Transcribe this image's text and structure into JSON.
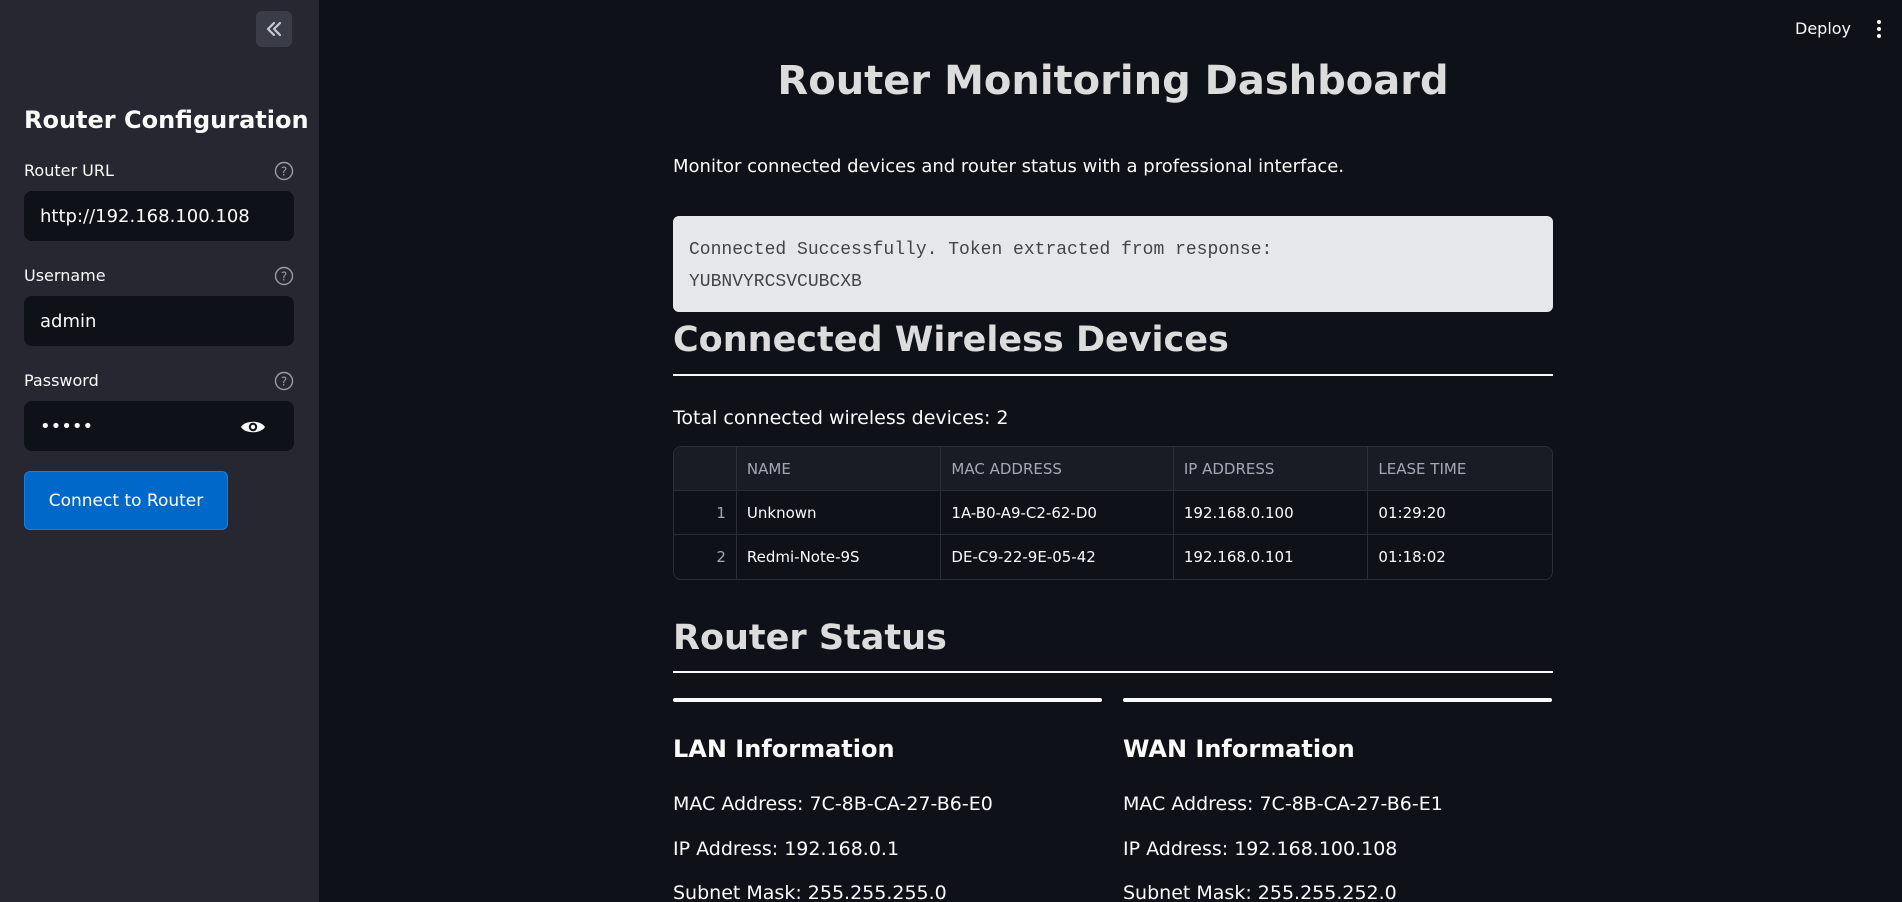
{
  "sidebar": {
    "title": "Router Configuration",
    "router_url": {
      "label": "Router URL",
      "value": "http://192.168.100.108"
    },
    "username": {
      "label": "Username",
      "value": "admin"
    },
    "password": {
      "label": "Password",
      "value": "•••••"
    },
    "connect_label": "Connect to Router"
  },
  "header": {
    "deploy_label": "Deploy"
  },
  "main": {
    "title": "Router Monitoring Dashboard",
    "intro": "Monitor connected devices and router status with a professional interface.",
    "status_line1": "Connected Successfully. Token extracted from response:",
    "status_line2": "YUBNVYRCSVCUBCXB",
    "devices_heading": "Connected Wireless Devices",
    "device_count": "Total connected wireless devices: 2",
    "table": {
      "headers": [
        "NAME",
        "MAC ADDRESS",
        "IP ADDRESS",
        "LEASE TIME"
      ],
      "rows": [
        {
          "idx": "1",
          "name": "Unknown",
          "mac": "1A-B0-A9-C2-62-D0",
          "ip": "192.168.0.100",
          "lease": "01:29:20"
        },
        {
          "idx": "2",
          "name": "Redmi-Note-9S",
          "mac": "DE-C9-22-9E-05-42",
          "ip": "192.168.0.101",
          "lease": "01:18:02"
        }
      ]
    },
    "status_heading": "Router Status",
    "lan": {
      "title": "LAN Information",
      "mac": "MAC Address: 7C-8B-CA-27-B6-E0",
      "ip": "IP Address: 192.168.0.1",
      "subnet": "Subnet Mask: 255.255.255.0"
    },
    "wan": {
      "title": "WAN Information",
      "mac": "MAC Address: 7C-8B-CA-27-B6-E1",
      "ip": "IP Address: 192.168.100.108",
      "subnet": "Subnet Mask: 255.255.252.0"
    }
  },
  "icons": {
    "collapse": "double-chevron-left-icon",
    "help": "question-circle-icon",
    "eye": "eye-icon",
    "menu": "kebab-menu-icon"
  },
  "colors": {
    "background": "#0e1117",
    "sidebar": "#262730",
    "primary_button": "#0068c9",
    "code_box": "#e6e7eb"
  }
}
